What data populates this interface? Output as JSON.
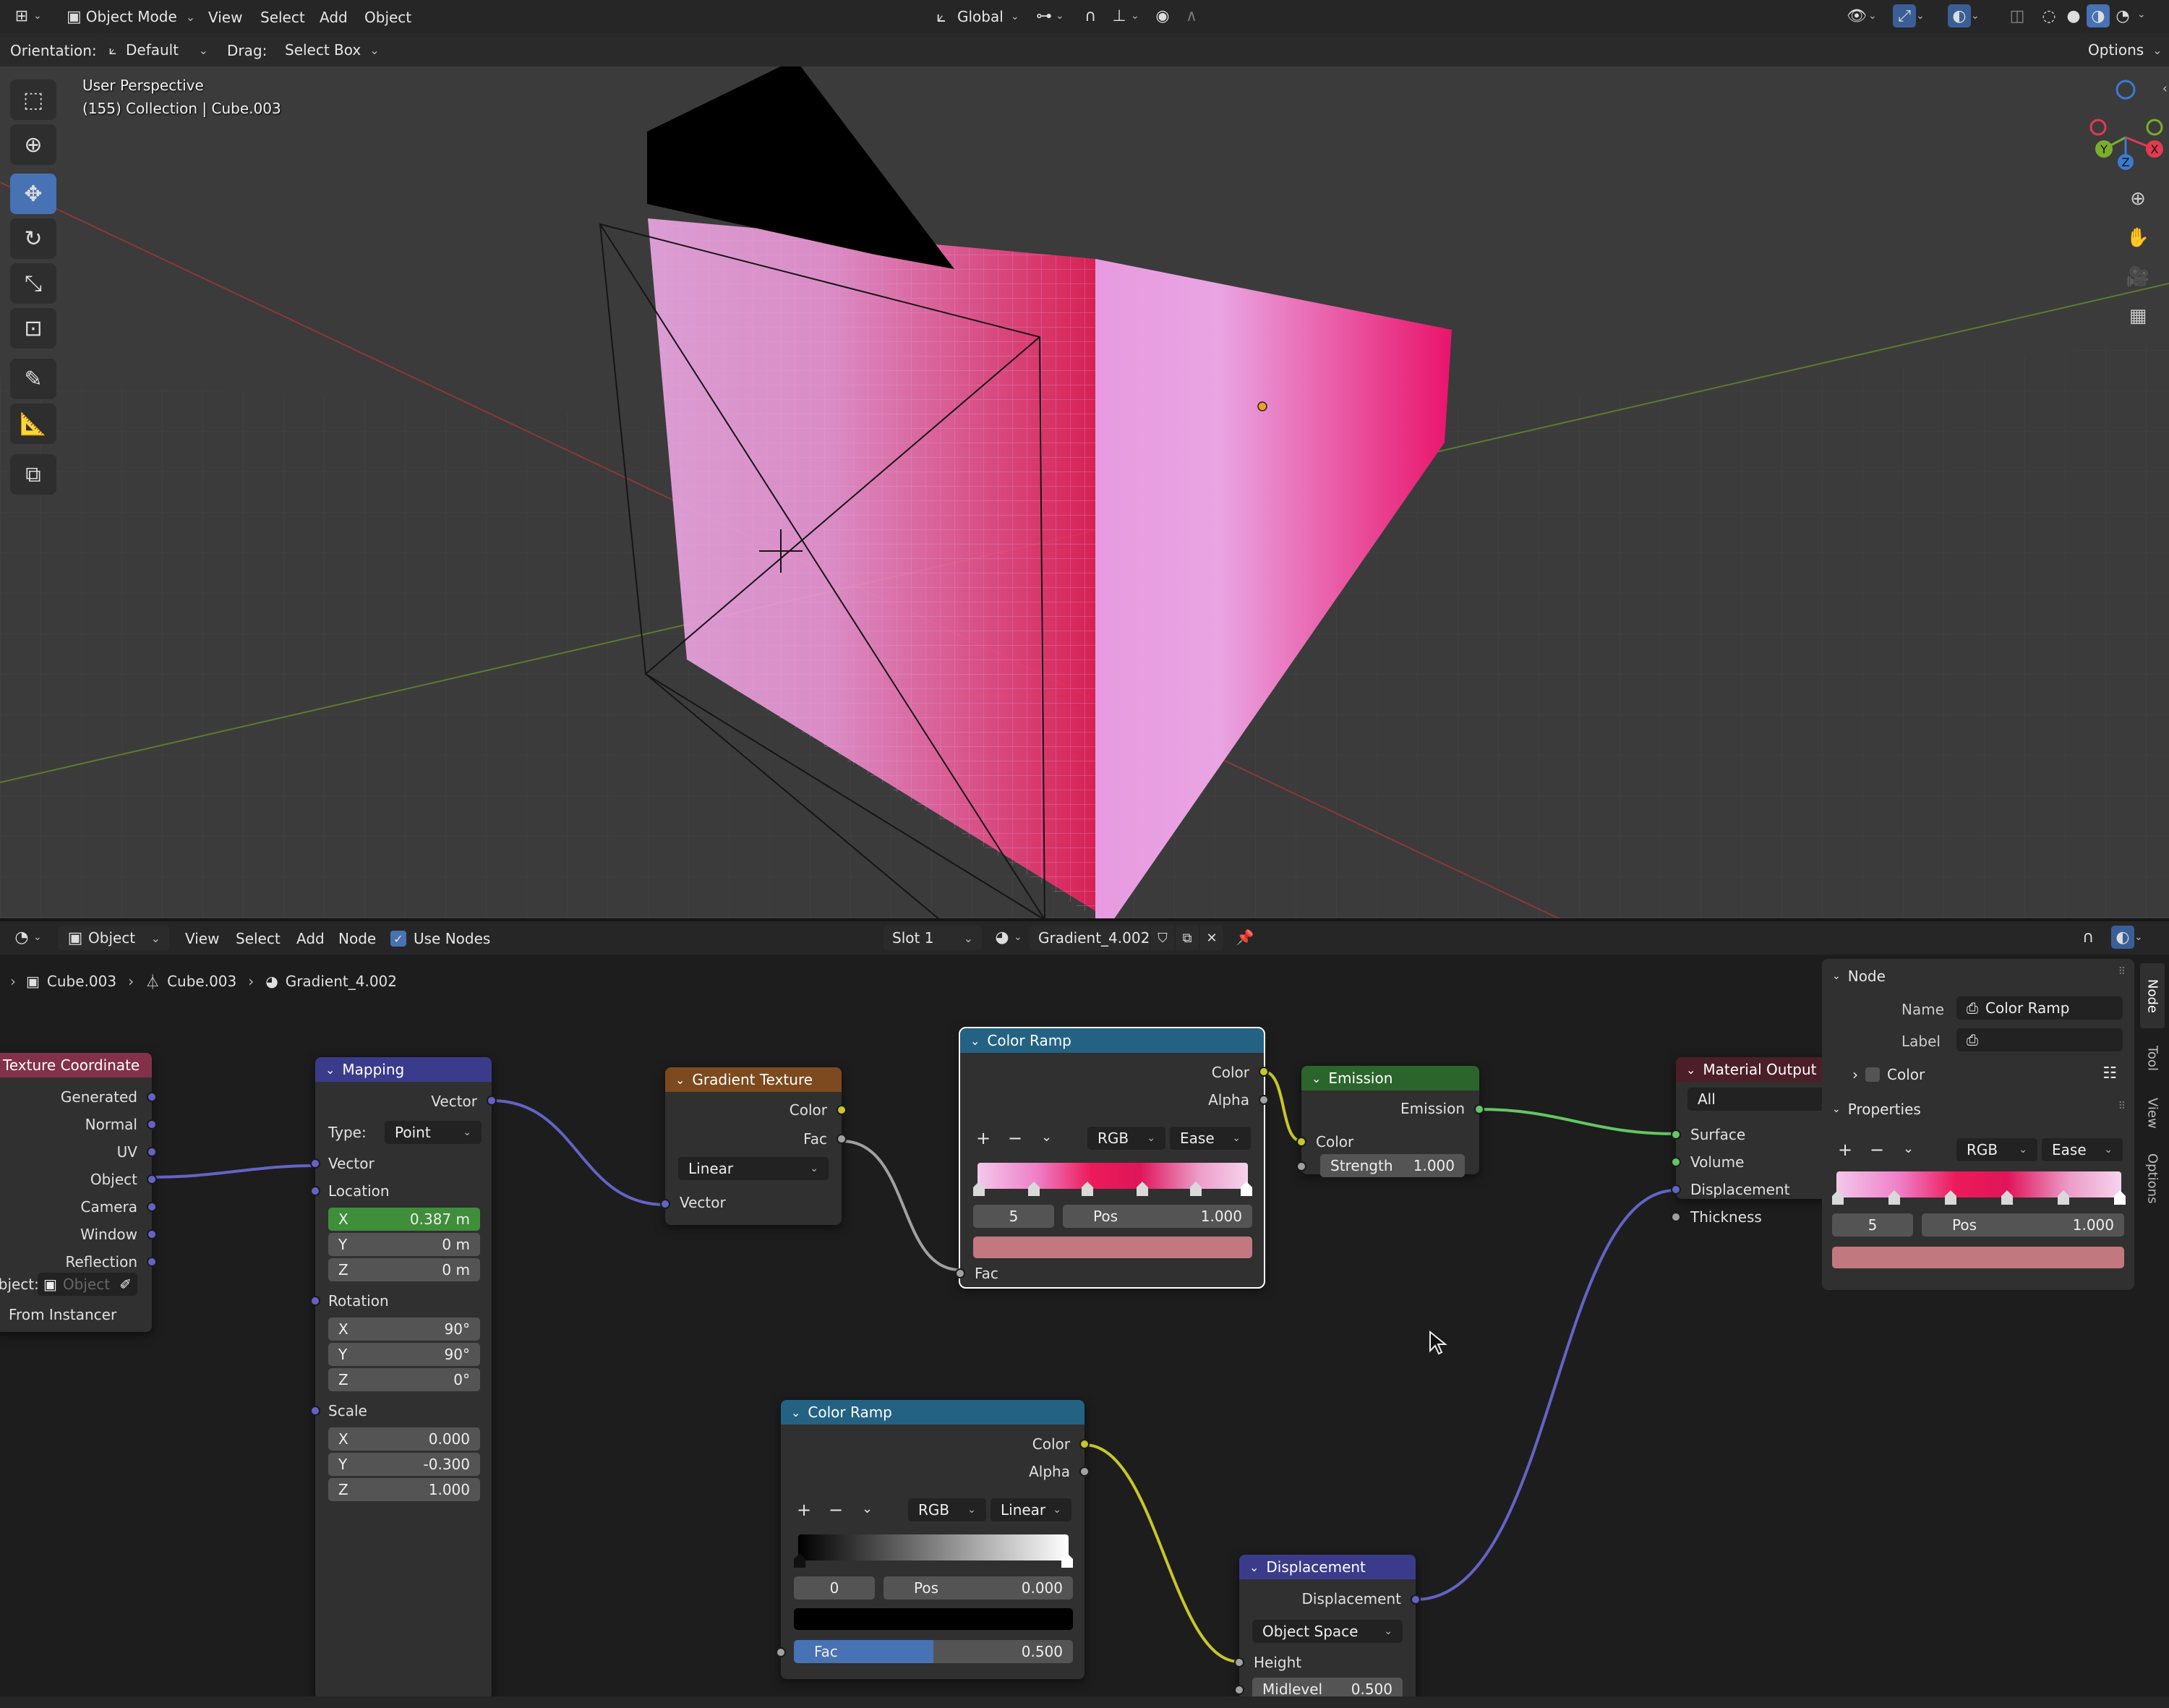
{
  "topbar": {
    "mode": "Object Mode",
    "menus": [
      "View",
      "Select",
      "Add",
      "Object"
    ],
    "transform_orientation": "Global"
  },
  "toolsettings": {
    "orientation_label": "Orientation:",
    "orientation_value": "Default",
    "drag_label": "Drag:",
    "drag_value": "Select Box",
    "options_label": "Options"
  },
  "viewport": {
    "view_name": "User Perspective",
    "collection_info": "(155) Collection | Cube.003",
    "gizmo_axes": [
      "X",
      "Y",
      "Z"
    ]
  },
  "node_editor": {
    "header": {
      "editor_type": "Object",
      "menus": [
        "View",
        "Select",
        "Add",
        "Node"
      ],
      "use_nodes_label": "Use Nodes",
      "slot": "Slot 1",
      "material": "Gradient_4.002"
    },
    "breadcrumb": [
      "Cube.003",
      "Cube.003",
      "Gradient_4.002"
    ],
    "nodes": {
      "texcoord": {
        "title": "Texture Coordinate",
        "outputs": [
          "Generated",
          "Normal",
          "UV",
          "Object",
          "Camera",
          "Window",
          "Reflection"
        ],
        "object_label": "Object:",
        "object_placeholder": "Object",
        "from_instancer": "From Instancer"
      },
      "mapping": {
        "title": "Mapping",
        "output": "Vector",
        "type_label": "Type:",
        "type_value": "Point",
        "input_vector": "Vector",
        "location_label": "Location",
        "location": [
          {
            "axis": "X",
            "value": "0.387 m"
          },
          {
            "axis": "Y",
            "value": "0 m"
          },
          {
            "axis": "Z",
            "value": "0 m"
          }
        ],
        "rotation_label": "Rotation",
        "rotation": [
          {
            "axis": "X",
            "value": "90°"
          },
          {
            "axis": "Y",
            "value": "90°"
          },
          {
            "axis": "Z",
            "value": "0°"
          }
        ],
        "scale_label": "Scale",
        "scale": [
          {
            "axis": "X",
            "value": "0.000"
          },
          {
            "axis": "Y",
            "value": "-0.300"
          },
          {
            "axis": "Z",
            "value": "1.000"
          }
        ]
      },
      "gradient": {
        "title": "Gradient Texture",
        "outputs": [
          "Color",
          "Fac"
        ],
        "type_value": "Linear",
        "input": "Vector"
      },
      "ramp1": {
        "title": "Color Ramp",
        "outputs": [
          "Color",
          "Alpha"
        ],
        "mode": "RGB",
        "interp": "Ease",
        "index": "5",
        "pos_label": "Pos",
        "pos_value": "1.000",
        "input": "Fac"
      },
      "emission": {
        "title": "Emission",
        "output": "Emission",
        "input_color": "Color",
        "strength_label": "Strength",
        "strength_value": "1.000"
      },
      "output": {
        "title": "Material Output",
        "target": "All",
        "inputs": [
          "Surface",
          "Volume",
          "Displacement",
          "Thickness"
        ]
      },
      "ramp2": {
        "title": "Color Ramp",
        "outputs": [
          "Color",
          "Alpha"
        ],
        "mode": "RGB",
        "interp": "Linear",
        "index": "0",
        "pos_label": "Pos",
        "pos_value": "0.000",
        "fac_label": "Fac",
        "fac_value": "0.500"
      },
      "displacement": {
        "title": "Displacement",
        "output": "Displacement",
        "space": "Object Space",
        "height_label": "Height",
        "midlevel_label": "Midlevel",
        "midlevel_value": "0.500"
      }
    },
    "sidebar": {
      "node_section": "Node",
      "name_label": "Name",
      "name_value": "Color Ramp",
      "label_label": "Label",
      "label_value": "",
      "color_section": "Color",
      "properties_section": "Properties",
      "mode": "RGB",
      "interp": "Ease",
      "index": "5",
      "pos_label": "Pos",
      "pos_value": "1.000",
      "tabs": [
        "Node",
        "Tool",
        "View",
        "Options"
      ]
    }
  },
  "colors": {
    "accent": "#4772b3",
    "socket_color": "#c7c729",
    "socket_vector": "#6363c7",
    "socket_shader": "#63c763",
    "socket_float": "#a1a1a1",
    "header_input": "#83314a",
    "header_vector": "#3b3b8c",
    "header_texture": "#7c4a1e",
    "header_converter": "#246283",
    "header_shader": "#2b652b",
    "header_output": "#4c1f28",
    "mapping_active": "#3f8e3a",
    "ramp_swatch": "#c2787f"
  }
}
